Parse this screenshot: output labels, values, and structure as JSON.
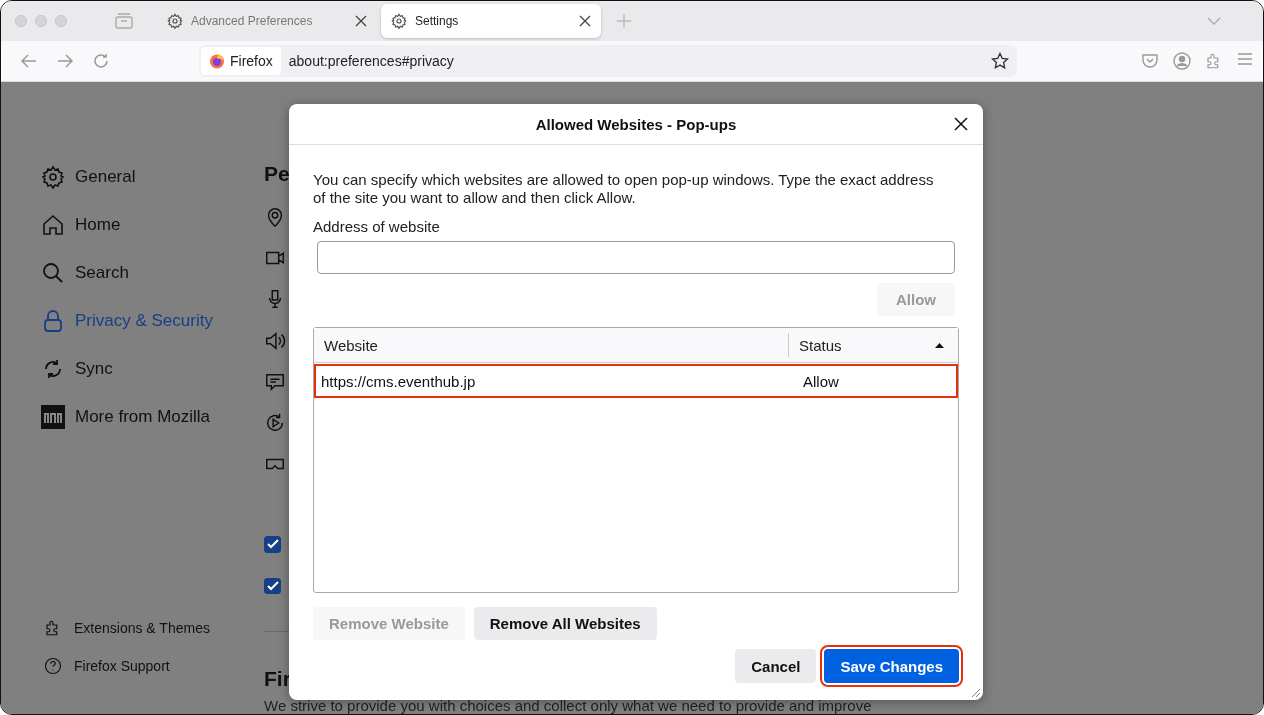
{
  "tabs": [
    {
      "label": "Advanced Preferences",
      "selected": false
    },
    {
      "label": "Settings",
      "selected": true
    }
  ],
  "toolbar": {
    "identity_label": "Firefox",
    "url": "about:preferences#privacy"
  },
  "sidebar": {
    "items": [
      {
        "label": "General",
        "selected": false
      },
      {
        "label": "Home",
        "selected": false
      },
      {
        "label": "Search",
        "selected": false
      },
      {
        "label": "Privacy & Security",
        "selected": true
      },
      {
        "label": "Sync",
        "selected": false
      },
      {
        "label": "More from Mozilla",
        "selected": false
      }
    ],
    "footer_items": [
      {
        "label": "Extensions & Themes"
      },
      {
        "label": "Firefox Support"
      }
    ]
  },
  "content": {
    "heading_1": "Pe",
    "checkboxes": [
      {
        "checked": true
      },
      {
        "checked": true
      }
    ],
    "heading_2": "Fir",
    "paragraph": "We strive to provide you with choices and collect only what we need to provide and improve"
  },
  "dialog": {
    "title": "Allowed Websites - Pop-ups",
    "description": "You can specify which websites are allowed to open pop-up windows. Type the exact address of the site you want to allow and then click Allow.",
    "address_label": "Address of website",
    "allow_button": {
      "label": "Allow",
      "disabled": true
    },
    "table": {
      "columns": [
        {
          "label": "Website",
          "sorted": false
        },
        {
          "label": "Status",
          "sorted": true
        }
      ],
      "rows": [
        {
          "website": "https://cms.eventhub.jp",
          "status": "Allow",
          "highlighted": true
        }
      ]
    },
    "buttons": [
      {
        "label": "Remove Website",
        "disabled": true
      },
      {
        "label": "Remove All Websites",
        "disabled": false
      }
    ],
    "footer_buttons": [
      {
        "label": "Cancel",
        "kind": "secondary",
        "highlighted": false
      },
      {
        "label": "Save Changes",
        "kind": "primary",
        "highlighted": true
      }
    ]
  }
}
